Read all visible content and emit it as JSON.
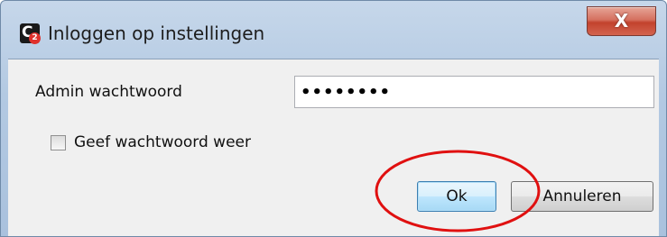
{
  "window": {
    "title": "Inloggen op instellingen",
    "app_icon_letter": "C",
    "app_icon_badge": "2",
    "close_glyph": "X",
    "close_icon": "close-icon"
  },
  "form": {
    "password_label": "Admin wachtwoord",
    "password_value": "••••••••",
    "show_password_label": "Geef wachtwoord weer",
    "show_password_checked": false
  },
  "buttons": {
    "ok_label": "Ok",
    "cancel_label": "Annuleren"
  },
  "colors": {
    "annotation": "#e01010",
    "close_button": "#c2422d",
    "default_button_border": "#3c7fb1"
  }
}
